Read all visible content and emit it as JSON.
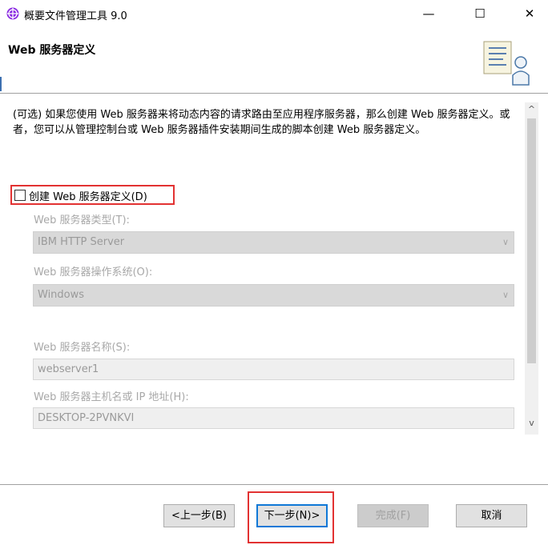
{
  "window": {
    "title": "概要文件管理工具 9.0",
    "controls": {
      "minimize": "—",
      "maximize": "☐",
      "close": "✕"
    }
  },
  "header": {
    "title": "Web 服务器定义",
    "illustration_icon": "document-person-icon"
  },
  "content": {
    "description": "(可选) 如果您使用 Web 服务器来将动态内容的请求路由至应用程序服务器，那么创建 Web 服务器定义。或者，您可以从管理控制台或 Web 服务器插件安装期间生成的脚本创建 Web 服务器定义。",
    "create_checkbox": {
      "label": "创建 Web 服务器定义(D)",
      "checked": false
    },
    "web_server_type": {
      "label": "Web 服务器类型(T):",
      "value": "IBM HTTP Server"
    },
    "web_server_os": {
      "label": "Web 服务器操作系统(O):",
      "value": "Windows"
    },
    "web_server_name": {
      "label": "Web 服务器名称(S):",
      "value": "webserver1"
    },
    "web_server_host": {
      "label": "Web 服务器主机名或 IP 地址(H):",
      "value": "DESKTOP-2PVNKVI"
    }
  },
  "scrollbar": {
    "up": "^",
    "down": "v"
  },
  "footer": {
    "back": "<上一步(B)",
    "next": "下一步(N)>",
    "finish": "完成(F)",
    "cancel": "取消"
  },
  "colors": {
    "highlight": "#e23232",
    "focus_border": "#0f78d7",
    "disabled_text": "#a8a8a8"
  }
}
